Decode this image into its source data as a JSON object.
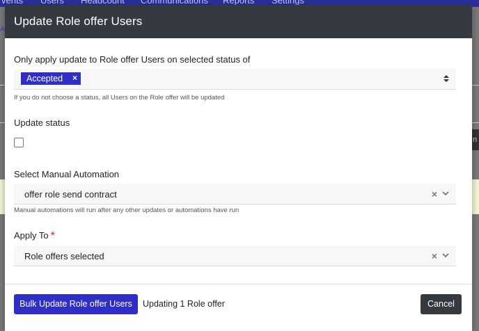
{
  "background": {
    "nav_items": [
      "vents",
      "Users",
      "Headcount",
      "Communications",
      "Reports",
      "Settings"
    ],
    "crumb": "A",
    "side_text": "n"
  },
  "modal": {
    "title": "Update Role offer Users",
    "status_filter": {
      "label": "Only apply update to Role offer Users on selected status of",
      "selected_chip": "Accepted",
      "chip_remove": "×",
      "help": "If you do not choose a status, all Users on the Role offer will be updated"
    },
    "update_status": {
      "label": "Update status",
      "checked": false
    },
    "manual_automation": {
      "label": "Select Manual Automation",
      "value": "offer role send contract",
      "clear": "×",
      "help": "Manual automations will run after any other updates or automations have run"
    },
    "apply_to": {
      "label": "Apply To",
      "required_mark": "*",
      "value": "Role offers selected",
      "clear": "×"
    },
    "footer": {
      "submit_label": "Bulk Update Role offer Users",
      "status_text": "Updating 1 Role offer",
      "cancel_label": "Cancel"
    }
  },
  "colors": {
    "header": "#343a40",
    "primary": "#2f2fc8",
    "required": "#e02424"
  }
}
